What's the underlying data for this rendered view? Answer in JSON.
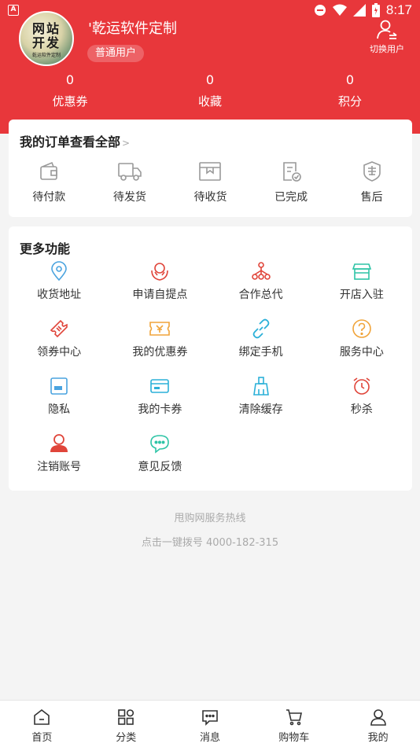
{
  "status_bar": {
    "time": "8:17",
    "left_glyph": "A"
  },
  "profile": {
    "avatar_text": "网站\n开发",
    "avatar_sub": "乾运软件定制",
    "username": "'乾运软件定制",
    "user_type": "普通用户",
    "switch_label": "切换用户"
  },
  "stats": [
    {
      "value": "0",
      "label": "优惠券"
    },
    {
      "value": "0",
      "label": "收藏"
    },
    {
      "value": "0",
      "label": "积分"
    }
  ],
  "orders": {
    "title": "我的订单查看全部",
    "chevron": ">",
    "items": [
      {
        "label": "待付款",
        "icon": "wallet-icon"
      },
      {
        "label": "待发货",
        "icon": "truck-icon"
      },
      {
        "label": "待收货",
        "icon": "package-icon"
      },
      {
        "label": "已完成",
        "icon": "completed-doc-icon"
      },
      {
        "label": "售后",
        "icon": "after-sales-shield-icon"
      }
    ]
  },
  "more": {
    "title": "更多功能",
    "items": [
      {
        "label": "收货地址",
        "icon": "location-pin-icon",
        "color": "#4aa3df"
      },
      {
        "label": "申请自提点",
        "icon": "hands-icon",
        "color": "#e0453a"
      },
      {
        "label": "合作总代",
        "icon": "network-icon",
        "color": "#e0453a"
      },
      {
        "label": "开店入驻",
        "icon": "store-icon",
        "color": "#2ec4a6"
      },
      {
        "label": "领券中心",
        "icon": "ticket-icon",
        "color": "#e0453a"
      },
      {
        "label": "我的优惠券",
        "icon": "coupon-icon",
        "color": "#f0a43a"
      },
      {
        "label": "绑定手机",
        "icon": "link-icon",
        "color": "#2bb0d8"
      },
      {
        "label": "服务中心",
        "icon": "question-icon",
        "color": "#f0a43a"
      },
      {
        "label": "隐私",
        "icon": "privacy-card-icon",
        "color": "#4aa3df"
      },
      {
        "label": "我的卡券",
        "icon": "card-icon",
        "color": "#2bb0d8"
      },
      {
        "label": "清除缓存",
        "icon": "broom-icon",
        "color": "#2bb0d8"
      },
      {
        "label": "秒杀",
        "icon": "alarm-icon",
        "color": "#e0453a"
      },
      {
        "label": "注销账号",
        "icon": "user-icon",
        "color": "#e0453a"
      },
      {
        "label": "意见反馈",
        "icon": "chat-bubble-icon",
        "color": "#2ec4a6"
      }
    ]
  },
  "hotline": {
    "title": "甩购网服务热线",
    "phone_text": "点击一键拨号 4000-182-315"
  },
  "bottom_nav": [
    {
      "label": "首页",
      "icon": "home-icon"
    },
    {
      "label": "分类",
      "icon": "category-icon"
    },
    {
      "label": "消息",
      "icon": "message-icon"
    },
    {
      "label": "购物车",
      "icon": "cart-icon"
    },
    {
      "label": "我的",
      "icon": "profile-icon"
    }
  ],
  "colors": {
    "brand_red": "#e8373b",
    "background": "#f4f4f4"
  }
}
